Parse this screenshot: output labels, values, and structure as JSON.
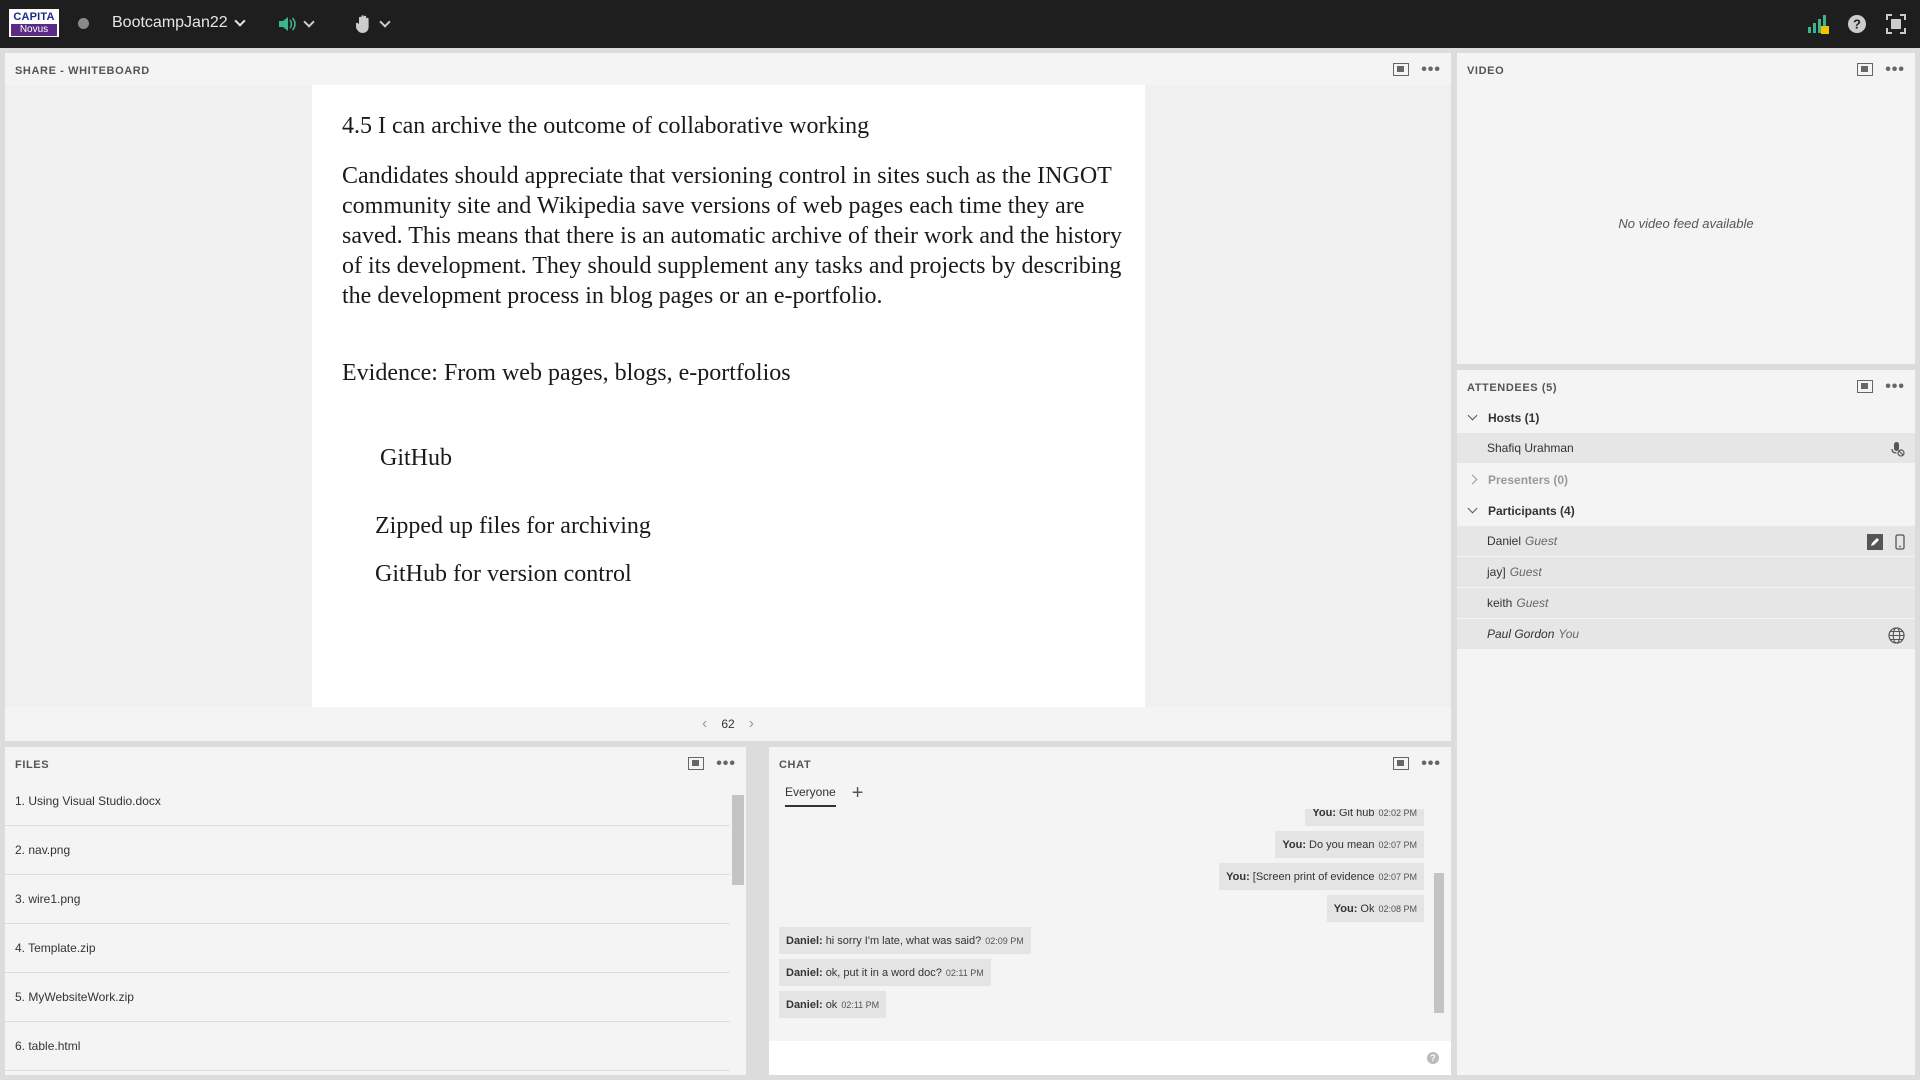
{
  "app": {
    "logo_line1": "CAPITA",
    "logo_line2": "Novus",
    "meeting_name": "BootcampJan22"
  },
  "share": {
    "header": "SHARE - WHITEBOARD",
    "slide": {
      "title": "4.5 I can archive the outcome of collaborative working",
      "body": "Candidates should appreciate that versioning control in sites such as the INGOT community site and Wikipedia save versions of web pages each time they are saved. This means that there is an automatic archive of their work and the history of its development. They should supplement any tasks and projects by describing the development process in blog pages or an e-portfolio.",
      "evidence": "Evidence: From web pages, blogs, e-portfolios",
      "github": "GitHub",
      "zipped": "Zipped up files for archiving",
      "version": "GitHub for version control"
    },
    "page_number": "62"
  },
  "video": {
    "header": "VIDEO",
    "empty_message": "No video feed available"
  },
  "attendees": {
    "header": "ATTENDEES  (5)",
    "hosts_label": "Hosts (1)",
    "hosts": [
      {
        "name": "Shafiq Urahman"
      }
    ],
    "presenters_label": "Presenters (0)",
    "participants_label": "Participants (4)",
    "participants": [
      {
        "name": "Daniel",
        "role": "Guest"
      },
      {
        "name": "jay]",
        "role": "Guest"
      },
      {
        "name": "keith",
        "role": "Guest"
      },
      {
        "name": "Paul Gordon",
        "role": "You"
      }
    ]
  },
  "files": {
    "header": "FILES",
    "items": [
      "1. Using Visual Studio.docx",
      "2. nav.png",
      "3. wire1.png",
      "4. Template.zip",
      "5. MyWebsiteWork.zip",
      "6. table.html"
    ]
  },
  "chat": {
    "header": "CHAT",
    "tab": "Everyone",
    "messages": [
      {
        "sender": "You:",
        "text": "Git hub",
        "time": "02:02 PM"
      },
      {
        "sender": "You:",
        "text": "Do you mean",
        "time": "02:07 PM"
      },
      {
        "sender": "You:",
        "text": "[Screen print of evidence",
        "time": "02:07 PM"
      },
      {
        "sender": "You:",
        "text": "Ok",
        "time": "02:08 PM"
      },
      {
        "sender": "Daniel:",
        "text": "hi sorry I'm late, what was said?",
        "time": "02:09 PM"
      },
      {
        "sender": "Daniel:",
        "text": "ok, put it in a word doc?",
        "time": "02:11 PM"
      },
      {
        "sender": "Daniel:",
        "text": "ok",
        "time": "02:11 PM"
      }
    ]
  }
}
